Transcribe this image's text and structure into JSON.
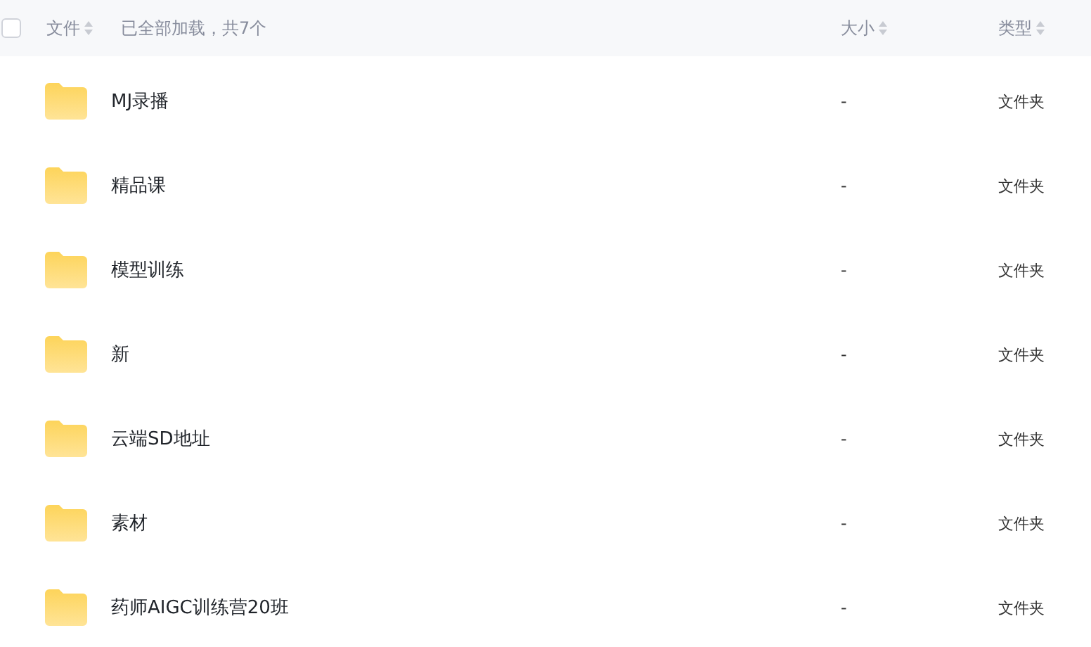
{
  "header": {
    "select_all": {
      "checked": false
    },
    "columns": [
      {
        "label": "文件"
      },
      {
        "label": "大小"
      },
      {
        "label": "类型"
      }
    ],
    "status": "已全部加载，共7个"
  },
  "rows": [
    {
      "name": "MJ录播",
      "size": "-",
      "type": "文件夹"
    },
    {
      "name": "精品课",
      "size": "-",
      "type": "文件夹"
    },
    {
      "name": "模型训练",
      "size": "-",
      "type": "文件夹"
    },
    {
      "name": "新",
      "size": "-",
      "type": "文件夹"
    },
    {
      "name": "云端SD地址",
      "size": "-",
      "type": "文件夹"
    },
    {
      "name": "素材",
      "size": "-",
      "type": "文件夹"
    },
    {
      "name": "药师AIGC训练营20班",
      "size": "-",
      "type": "文件夹"
    }
  ]
}
